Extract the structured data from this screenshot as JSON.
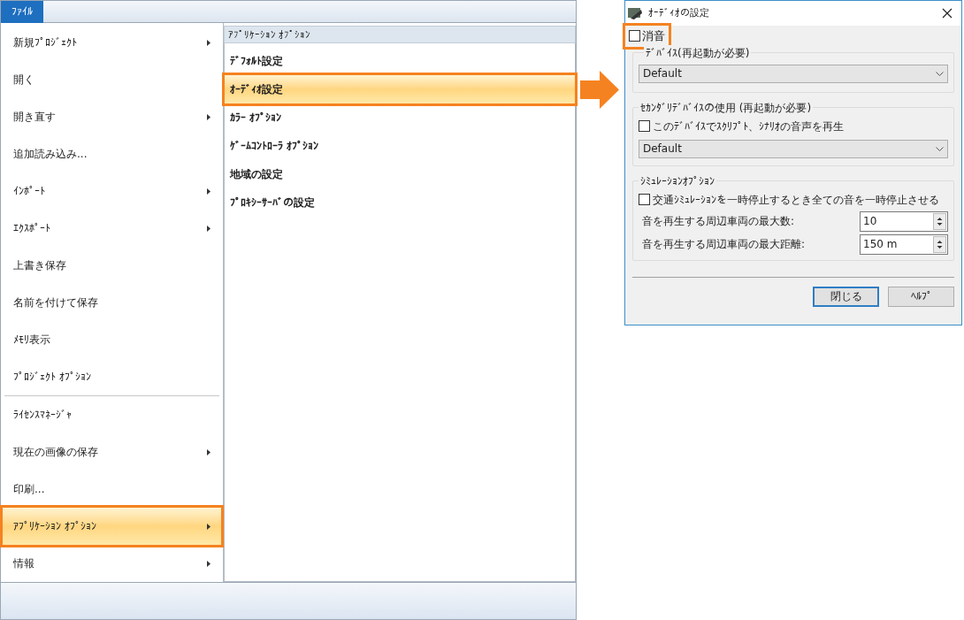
{
  "menu_tab": {
    "label": "ﾌｧｲﾙ"
  },
  "file_menu": {
    "items": [
      {
        "label": "新規ﾌﾟﾛｼﾞｪｸﾄ",
        "submenu": true,
        "selected": false
      },
      {
        "label": "開く",
        "submenu": false,
        "selected": false
      },
      {
        "label": "開き直す",
        "submenu": true,
        "selected": false
      },
      {
        "label": "追加読み込み...",
        "submenu": false,
        "selected": false
      },
      {
        "label": "ｲﾝﾎﾟｰﾄ",
        "submenu": true,
        "selected": false
      },
      {
        "label": "ｴｸｽﾎﾟｰﾄ",
        "submenu": true,
        "selected": false
      },
      {
        "label": "上書き保存",
        "submenu": false,
        "selected": false
      },
      {
        "label": "名前を付けて保存",
        "submenu": false,
        "selected": false
      },
      {
        "label": "ﾒﾓﾘ表示",
        "submenu": false,
        "selected": false
      },
      {
        "label": "ﾌﾟﾛｼﾞｪｸﾄ ｵﾌﾟｼｮﾝ",
        "submenu": false,
        "selected": false
      },
      {
        "kind": "divider"
      },
      {
        "label": "ﾗｲｾﾝｽﾏﾈｰｼﾞｬ",
        "submenu": false,
        "selected": false
      },
      {
        "label": "現在の画像の保存",
        "submenu": true,
        "selected": false
      },
      {
        "label": "印刷...",
        "submenu": false,
        "selected": false
      },
      {
        "label": "ｱﾌﾟﾘｹｰｼｮﾝ ｵﾌﾟｼｮﾝ",
        "submenu": true,
        "selected": true
      },
      {
        "label": "情報",
        "submenu": true,
        "selected": false
      }
    ]
  },
  "submenu": {
    "title": "ｱﾌﾟﾘｹｰｼｮﾝ ｵﾌﾟｼｮﾝ",
    "items": [
      {
        "label": "ﾃﾞﾌｫﾙﾄ設定",
        "selected": false
      },
      {
        "label": "ｵｰﾃﾞｨｵ設定",
        "selected": true
      },
      {
        "label": "ｶﾗｰ ｵﾌﾟｼｮﾝ",
        "selected": false
      },
      {
        "label": "ｹﾞｰﾑｺﾝﾄﾛｰﾗ ｵﾌﾟｼｮﾝ",
        "selected": false
      },
      {
        "label": "地域の設定",
        "selected": false
      },
      {
        "label": "ﾌﾟﾛｷｼｰｻｰﾊﾞの設定",
        "selected": false
      }
    ]
  },
  "dialog": {
    "title": "ｵｰﾃﾞｨｵの設定",
    "mute": {
      "label": "消音",
      "checked": false
    },
    "device_group": {
      "title": "ﾃﾞﾊﾞｲｽ(再起動が必要)",
      "dropdown": "Default"
    },
    "secondary_group": {
      "title": "ｾｶﾝﾀﾞﾘﾃﾞﾊﾞｲｽの使用 (再起動が必要)",
      "checkbox": {
        "label": "このﾃﾞﾊﾞｲｽでｽｸﾘﾌﾟﾄ、ｼﾅﾘｵの音声を再生",
        "checked": false
      },
      "dropdown": "Default"
    },
    "simulation_group": {
      "title": "ｼﾐｭﾚｰｼｮﾝｵﾌﾟｼｮﾝ",
      "checkbox": {
        "label": "交通ｼﾐｭﾚｰｼｮﾝを一時停止するとき全ての音を一時停止させる",
        "checked": false
      },
      "fields": [
        {
          "label": "音を再生する周辺車両の最大数:",
          "value": "10"
        },
        {
          "label": "音を再生する周辺車両の最大距離:",
          "value": "150 m"
        }
      ]
    },
    "buttons": [
      {
        "label": "閉じる",
        "default": true
      },
      {
        "label": "ﾍﾙﾌﾟ",
        "default": false
      }
    ]
  }
}
